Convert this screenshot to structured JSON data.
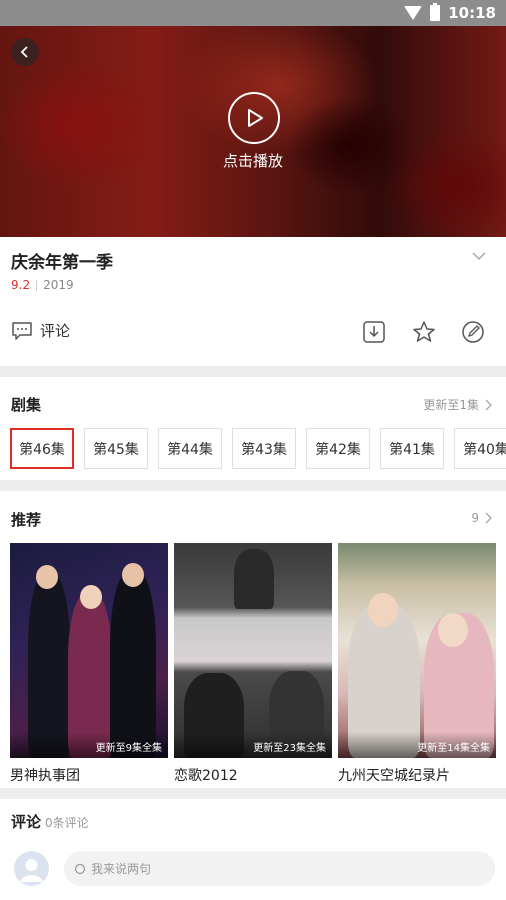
{
  "status_bar": {
    "time": "10:18"
  },
  "player": {
    "play_label": "点击播放"
  },
  "show": {
    "title": "庆余年第一季",
    "rating": "9.2",
    "year": "2019"
  },
  "actions": {
    "comment_label": "评论"
  },
  "episodes": {
    "title": "剧集",
    "update_text": "更新至1集",
    "items": [
      "第46集",
      "第45集",
      "第44集",
      "第43集",
      "第42集",
      "第41集",
      "第40集"
    ]
  },
  "recommend": {
    "title": "推荐",
    "count": "9",
    "items": [
      {
        "title": "男神执事团",
        "badge": "更新至9集全集"
      },
      {
        "title": "恋歌2012",
        "badge": "更新至23集全集"
      },
      {
        "title": "九州天空城纪录片",
        "badge": "更新至14集全集"
      }
    ]
  },
  "comments": {
    "title": "评论",
    "count_text": "0条评论",
    "input_placeholder": "我来说两句"
  },
  "colors": {
    "accent": "#e02e24",
    "status_bar": "#8d8d8d",
    "background": "#ededed"
  }
}
